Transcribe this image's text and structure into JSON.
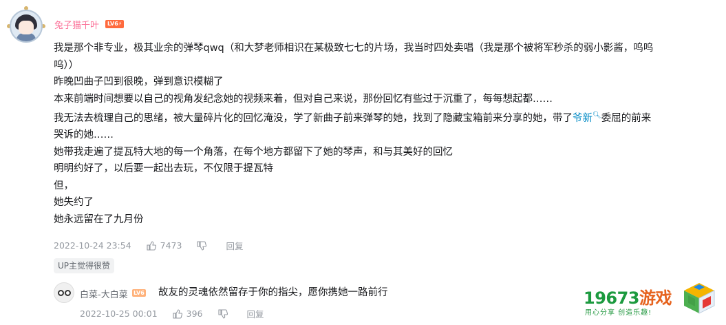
{
  "user": {
    "name": "兔子猫千叶",
    "level": "LV6⚡"
  },
  "comment": {
    "lines": [
      "我是那个非专业，极其业余的弹琴qwq（和大梦老师相识在某极致七七的片场，我当时四处卖唱（我是那个被将军秒杀的弱小影酱，呜呜",
      "呜））",
      "昨晚凹曲子凹到很晚，弹到意识模糊了",
      "本来前端时间想要以自己的视角发纪念她的视频来着，但对自己来说，那份回忆有些过于沉重了，每每想起都……"
    ],
    "line5_before": "我无法去梳理自己的思绪，被大量碎片化的回忆淹没，学了新曲子前来弹琴的她，找到了隐藏宝箱前来分享的她，带了",
    "topic_link": "爷新",
    "line5_after": "委屈的前来",
    "line6": "哭诉的她……",
    "lines_after": [
      "她带我走遍了提瓦特大地的每一个角落，在每个地方都留下了她的琴声，和与其美好的回忆",
      "明明约好了，以后要一起出去玩，不仅限于提瓦特",
      "但，",
      "她失约了",
      "她永远留在了九月份"
    ],
    "timestamp": "2022-10-24 23:54",
    "likes": "7473",
    "reply_label": "回复",
    "up_tag": "UP主觉得很赞"
  },
  "reply": {
    "name": "白菜-大白菜",
    "level": "LV6",
    "text": "故友的灵魂依然留存于你的指尖，愿你携她一路前行",
    "timestamp": "2022-10-25 00:01",
    "likes": "396",
    "reply_label": "回复"
  },
  "watermark": {
    "number": "19673",
    "brand": "游戏",
    "slogan": "用心分享  创造乐趣!"
  },
  "colors": {
    "username": "#fb7299",
    "link": "#008ac5",
    "meta": "#9499a0",
    "level_badge": "#ff6a3d"
  }
}
